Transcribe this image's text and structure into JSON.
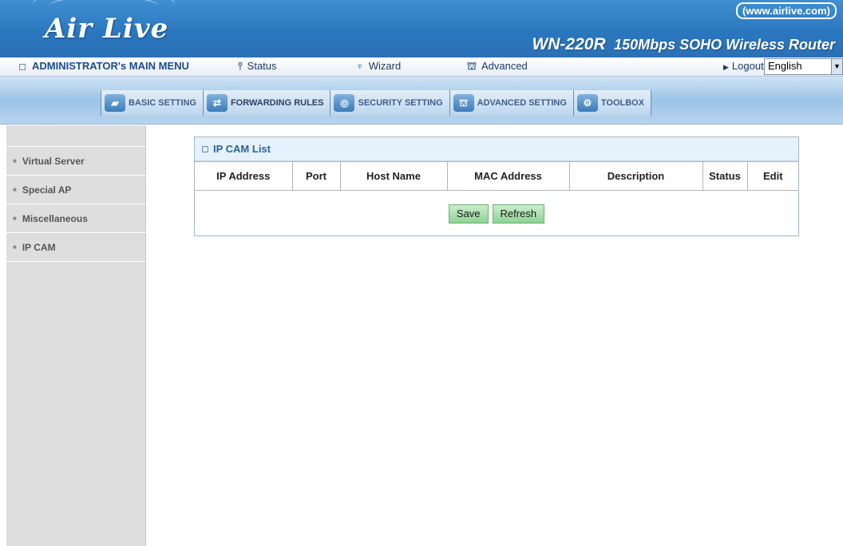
{
  "banner": {
    "logo": "Air Live",
    "url": "(www.airlive.com)",
    "model": "WN-220R",
    "description": "150Mbps SOHO Wireless Router"
  },
  "menu": {
    "admin": "ADMINISTRATOR's MAIN MENU",
    "status": "Status",
    "wizard": "Wizard",
    "advanced": "Advanced",
    "logout": "Logout",
    "language": "English"
  },
  "tabs": [
    {
      "label": "BASIC SETTING",
      "icon": "folder-icon"
    },
    {
      "label": "FORWARDING RULES",
      "icon": "forwarding-icon"
    },
    {
      "label": "SECURITY SETTING",
      "icon": "lock-icon"
    },
    {
      "label": "ADVANCED SETTING",
      "icon": "advanced-icon"
    },
    {
      "label": "TOOLBOX",
      "icon": "toolbox-icon"
    }
  ],
  "sidebar": {
    "items": [
      {
        "label": "Virtual Server"
      },
      {
        "label": "Special AP"
      },
      {
        "label": "Miscellaneous"
      },
      {
        "label": "IP CAM"
      }
    ]
  },
  "panel": {
    "title": "IP CAM List",
    "columns": [
      "IP Address",
      "Port",
      "Host Name",
      "MAC Address",
      "Description",
      "Status",
      "Edit"
    ],
    "save_label": "Save",
    "refresh_label": "Refresh"
  }
}
